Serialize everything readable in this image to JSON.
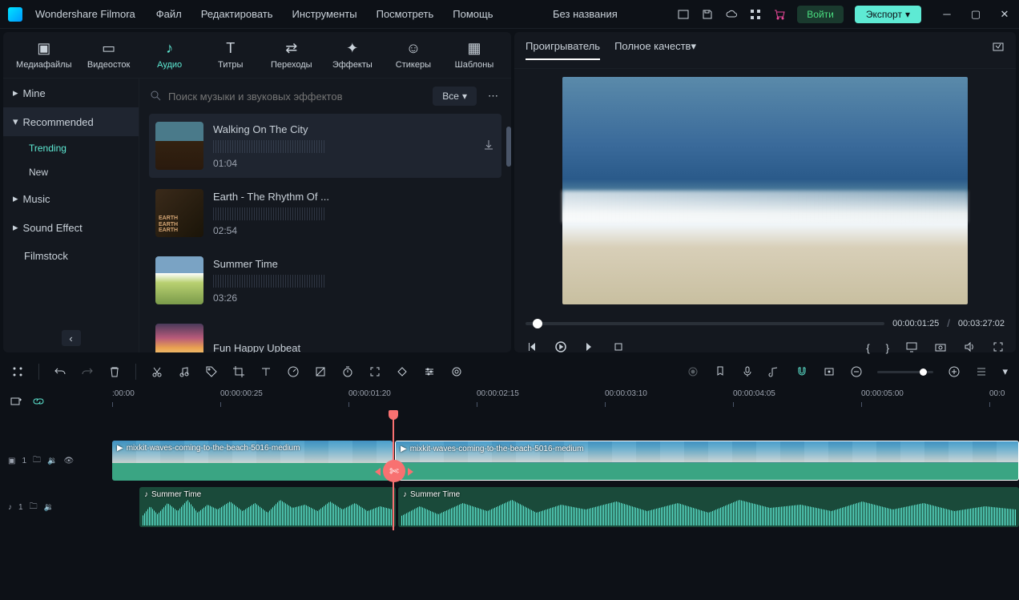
{
  "titlebar": {
    "app_name": "Wondershare Filmora",
    "menu": [
      "Файл",
      "Редактировать",
      "Инструменты",
      "Посмотреть",
      "Помощь"
    ],
    "project_title": "Без названия",
    "login_label": "Войти",
    "export_label": "Экспорт"
  },
  "media_tabs": [
    {
      "label": "Медиафайлы",
      "icon": "▣"
    },
    {
      "label": "Видеосток",
      "icon": "▭"
    },
    {
      "label": "Аудио",
      "icon": "♪",
      "active": true
    },
    {
      "label": "Титры",
      "icon": "T"
    },
    {
      "label": "Переходы",
      "icon": "⇄"
    },
    {
      "label": "Эффекты",
      "icon": "✦"
    },
    {
      "label": "Стикеры",
      "icon": "☺"
    },
    {
      "label": "Шаблоны",
      "icon": "▦"
    }
  ],
  "sidebar": {
    "items": [
      {
        "label": "Mine",
        "type": "group"
      },
      {
        "label": "Recommended",
        "type": "group",
        "active": true
      },
      {
        "label": "Trending",
        "type": "sub",
        "active": true
      },
      {
        "label": "New",
        "type": "sub"
      },
      {
        "label": "Music",
        "type": "group"
      },
      {
        "label": "Sound Effect",
        "type": "group"
      },
      {
        "label": "Filmstock",
        "type": "group"
      }
    ]
  },
  "search": {
    "placeholder": "Поиск музыки и звуковых эффектов",
    "filter_label": "Все"
  },
  "tracks": [
    {
      "title": "Walking On The City",
      "duration": "01:04",
      "thumb": "thumb1"
    },
    {
      "title": "Earth - The Rhythm Of ...",
      "duration": "02:54",
      "thumb": "thumb2"
    },
    {
      "title": "Summer Time",
      "duration": "03:26",
      "thumb": "thumb3"
    },
    {
      "title": "Fun Happy Upbeat",
      "duration": "",
      "thumb": "thumb4"
    }
  ],
  "preview": {
    "tab_player": "Проигрыватель",
    "tab_quality": "Полное качеств",
    "current_time": "00:00:01:25",
    "total_time": "00:03:27:02"
  },
  "timeline": {
    "ruler": [
      ":00:00",
      "00:00:00:25",
      "00:00:01:20",
      "00:00:02:15",
      "00:00:03:10",
      "00:00:04:05",
      "00:00:05:00",
      "00:0"
    ],
    "video_track": {
      "badge": "1",
      "head": "▣"
    },
    "audio_track": {
      "badge": "1",
      "head": "♪"
    },
    "clip_video_1": "mixkit-waves-coming-to-the-beach-5016-medium",
    "clip_video_2": "mixkit-waves-coming-to-the-beach-5016-medium",
    "clip_audio_1": "Summer Time",
    "clip_audio_2": "Summer Time"
  }
}
